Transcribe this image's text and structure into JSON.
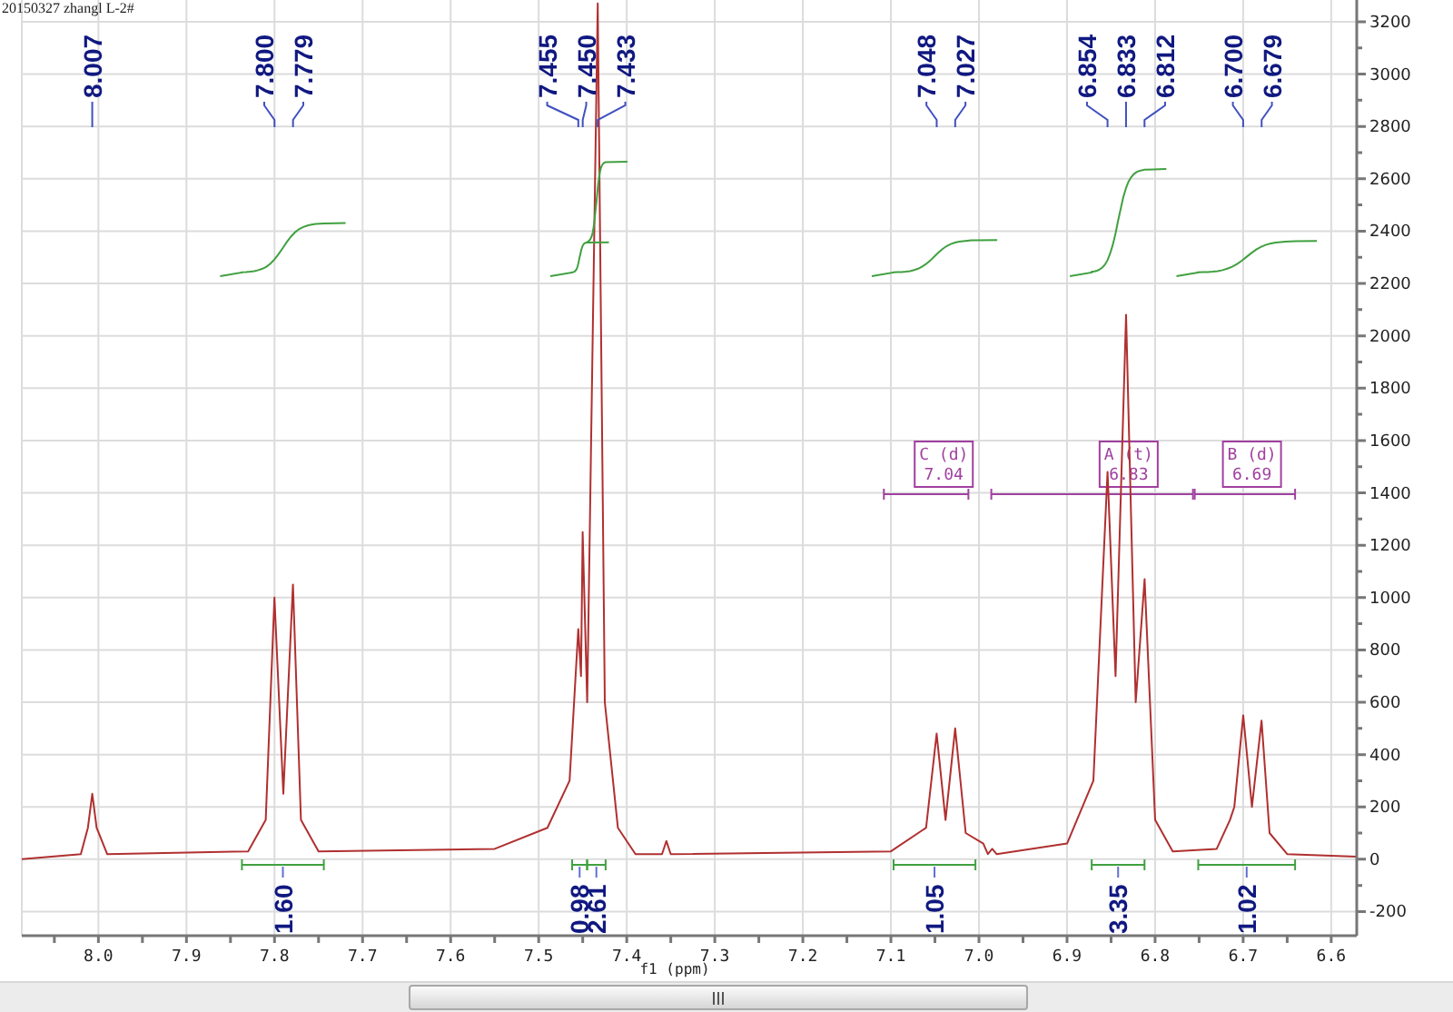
{
  "title": "20150327 zhangl L-2#",
  "spectrum": {
    "chart_data": {
      "type": "line",
      "xlabel": "f1 (ppm)",
      "xlim": [
        8.087,
        6.571
      ],
      "ylim": [
        -292,
        3283
      ],
      "grid": true,
      "xticks": [
        {
          "value": 8.0,
          "label": "8.0"
        },
        7.9,
        7.8,
        7.7,
        7.6,
        7.5,
        7.4,
        7.3,
        7.2,
        7.1,
        {
          "value": 7.0,
          "label": "7.0"
        },
        6.9,
        6.8,
        6.7,
        6.6
      ],
      "yticks": [
        -200,
        0,
        200,
        400,
        600,
        800,
        1000,
        1200,
        1400,
        1600,
        1800,
        2000,
        2200,
        2400,
        2600,
        2800,
        3000,
        3200
      ],
      "x": [
        8.087,
        8.02,
        8.012,
        8.007,
        8.002,
        7.99,
        7.83,
        7.81,
        7.8,
        7.79,
        7.779,
        7.77,
        7.75,
        7.55,
        7.49,
        7.465,
        7.455,
        7.452,
        7.45,
        7.445,
        7.433,
        7.425,
        7.41,
        7.39,
        7.36,
        7.355,
        7.35,
        7.1,
        7.06,
        7.048,
        7.038,
        7.027,
        7.015,
        6.995,
        6.99,
        6.985,
        6.98,
        6.9,
        6.87,
        6.854,
        6.845,
        6.833,
        6.822,
        6.812,
        6.8,
        6.78,
        6.73,
        6.715,
        6.71,
        6.7,
        6.69,
        6.679,
        6.67,
        6.65,
        6.571
      ],
      "series": [
        {
          "color": "#b03030",
          "values": [
            0,
            20,
            120,
            250,
            120,
            20,
            30,
            150,
            1000,
            250,
            1050,
            150,
            30,
            40,
            120,
            300,
            880,
            700,
            1250,
            600,
            3270,
            600,
            120,
            20,
            20,
            70,
            20,
            30,
            120,
            480,
            150,
            500,
            100,
            60,
            20,
            40,
            20,
            60,
            300,
            1480,
            700,
            2080,
            600,
            1070,
            150,
            30,
            40,
            150,
            200,
            550,
            200,
            530,
            100,
            20,
            10
          ]
        }
      ]
    },
    "peak_labels": [
      {
        "text": "8.007"
      },
      {
        "text": "7.800"
      },
      {
        "text": "7.779"
      },
      {
        "text": "7.455"
      },
      {
        "text": "7.450"
      },
      {
        "text": "7.433"
      },
      {
        "text": "7.048"
      },
      {
        "text": "7.027"
      },
      {
        "text": "6.854"
      },
      {
        "text": "6.833"
      },
      {
        "text": "6.812"
      },
      {
        "text": "6.700"
      },
      {
        "text": "6.679"
      }
    ],
    "multiplets": [
      {
        "label": "C (d)",
        "shift": "7.04"
      },
      {
        "label": "A (t)",
        "shift": "6.83"
      },
      {
        "label": "B (d)",
        "shift": "6.69"
      }
    ],
    "integrals": [
      {
        "value": "1.60"
      },
      {
        "value": "0.98"
      },
      {
        "value": "2.61"
      },
      {
        "value": "1.05"
      },
      {
        "value": "3.35"
      },
      {
        "value": "1.02"
      }
    ]
  }
}
